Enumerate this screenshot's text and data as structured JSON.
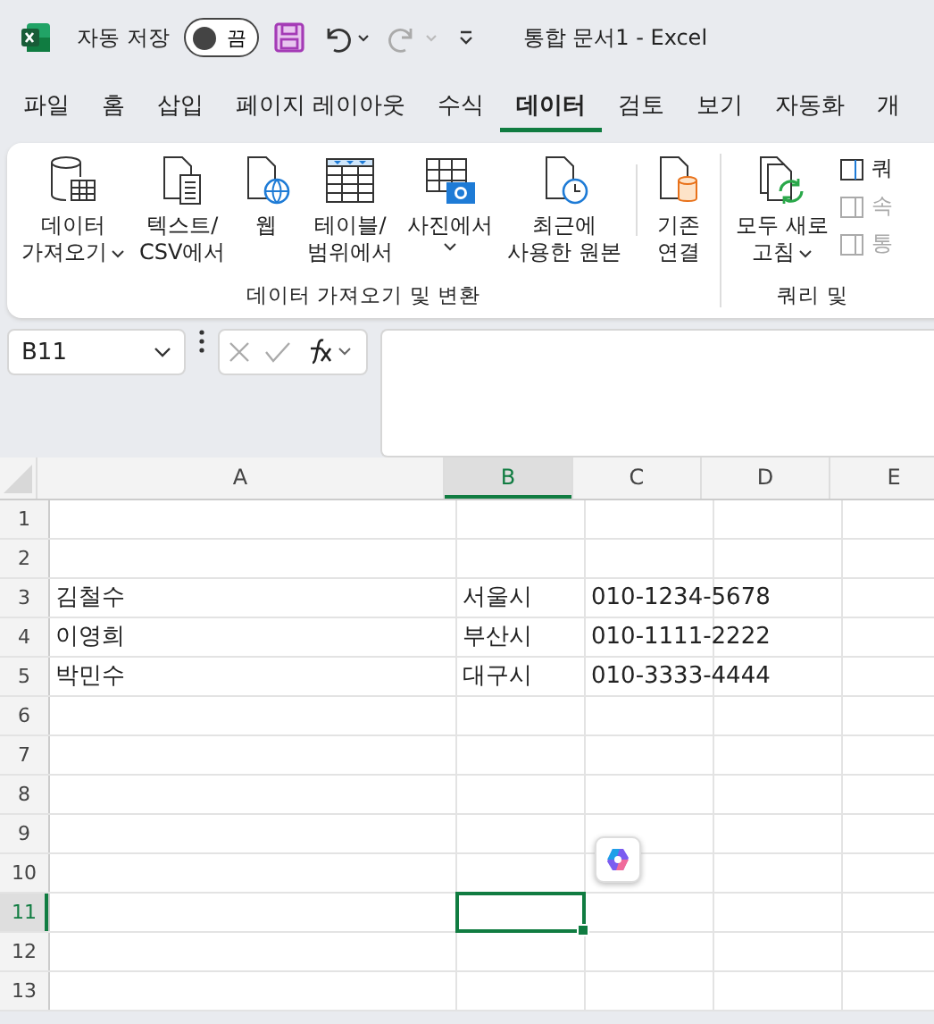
{
  "titlebar": {
    "autosave": {
      "label": "자동 저장",
      "on": false,
      "state_text": "끔"
    },
    "title": "통합 문서1  -  Excel"
  },
  "tabs": [
    {
      "label": "파일",
      "selected": false
    },
    {
      "label": "홈",
      "selected": false
    },
    {
      "label": "삽입",
      "selected": false
    },
    {
      "label": "페이지 레이아웃",
      "selected": false
    },
    {
      "label": "수식",
      "selected": false
    },
    {
      "label": "데이터",
      "selected": true
    },
    {
      "label": "검토",
      "selected": false
    },
    {
      "label": "보기",
      "selected": false
    },
    {
      "label": "자동화",
      "selected": false
    },
    {
      "label": "개",
      "selected": false
    }
  ],
  "ribbon": {
    "groups": [
      {
        "label": "데이터 가져오기 및 변환",
        "buttons": [
          {
            "lines": [
              "데이터",
              "가져오기"
            ],
            "dropdown": true
          },
          {
            "lines": [
              "텍스트/",
              "CSV에서"
            ],
            "dropdown": false
          },
          {
            "lines": [
              "웹"
            ],
            "dropdown": false
          },
          {
            "lines": [
              "테이블/",
              "범위에서"
            ],
            "dropdown": false
          },
          {
            "lines": [
              "사진에서"
            ],
            "dropdown": true
          },
          {
            "lines": [
              "최근에",
              "사용한 원본"
            ],
            "dropdown": false
          },
          {
            "lines": [
              "기존",
              "연결"
            ],
            "dropdown": false
          }
        ]
      },
      {
        "label": "쿼리 및",
        "buttons": [
          {
            "lines": [
              "모두 새로",
              "고침"
            ],
            "dropdown": true
          }
        ],
        "small_items": [
          {
            "label": "쿼",
            "disabled": false
          },
          {
            "label": "속",
            "disabled": true
          },
          {
            "label": "통",
            "disabled": true
          }
        ]
      }
    ]
  },
  "formula_bar": {
    "name_box": "B11"
  },
  "sheet": {
    "columns": [
      {
        "label": "A",
        "selected": false
      },
      {
        "label": "B",
        "selected": true
      },
      {
        "label": "C",
        "selected": false
      },
      {
        "label": "D",
        "selected": false
      },
      {
        "label": "E",
        "selected": false
      }
    ],
    "rows": [
      {
        "header": "1",
        "selected": false
      },
      {
        "header": "2",
        "selected": false
      },
      {
        "header": "3",
        "selected": false,
        "cells": [
          "김철수",
          "서울시",
          "010-1234-5678"
        ]
      },
      {
        "header": "4",
        "selected": false,
        "cells": [
          "이영희",
          "부산시",
          "010-1111-2222"
        ]
      },
      {
        "header": "5",
        "selected": false,
        "cells": [
          "박민수",
          "대구시",
          "010-3333-4444"
        ]
      },
      {
        "header": "6",
        "selected": false
      },
      {
        "header": "7",
        "selected": false
      },
      {
        "header": "8",
        "selected": false
      },
      {
        "header": "9",
        "selected": false
      },
      {
        "header": "10",
        "selected": false
      },
      {
        "header": "11",
        "selected": true
      },
      {
        "header": "12",
        "selected": false
      },
      {
        "header": "13",
        "selected": false
      }
    ]
  }
}
